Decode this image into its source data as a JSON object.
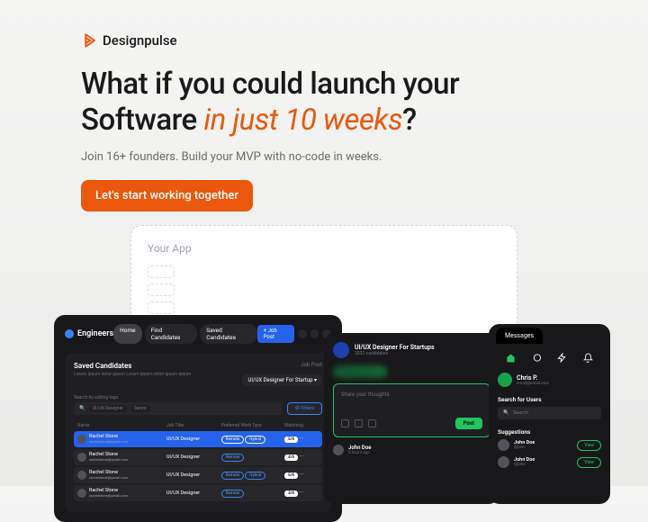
{
  "brand": "Designpulse",
  "headline_a": "What if you could launch your Software ",
  "headline_b": "in just 10 weeks",
  "headline_c": "?",
  "subhead": "Join 16+ founders. Build your MVP with no-code in weeks.",
  "cta": "Let's start working together",
  "wire": {
    "title": "Your App"
  },
  "eng": {
    "brand": "Engineers",
    "nav": [
      "Home",
      "Find Candidates",
      "Saved Candidates"
    ],
    "job_post_btn": "+ Job Post",
    "saved_title": "Saved Candidates",
    "lorem": "Lorum ipsum dolor ipsum Lorum ipsum dolor ipsum ipsum",
    "job_post_label": "Job Post",
    "job_post_value": "UI/UX Designer For Startup",
    "search_label": "Search by adding tags..",
    "tags": [
      "UI/UX Designer",
      "Senior"
    ],
    "filter": "Filters",
    "cols": [
      "Name",
      "Job Title",
      "Preferred Work Type",
      "Matching"
    ],
    "rows": [
      {
        "name": "Rachel Stone",
        "email": "rachelstone@gmail.com",
        "title": "UI/UX Designer",
        "types": [
          "Remote",
          "Hybrid"
        ],
        "match": "5/6",
        "sel": true
      },
      {
        "name": "Rachel Stone",
        "email": "rachelstone@gmail.com",
        "title": "UI/UX Designer",
        "types": [
          "Remote"
        ],
        "match": "4/6",
        "sel": false
      },
      {
        "name": "Rachel Stone",
        "email": "rachelstone@gmail.com",
        "title": "UI/UX Designer",
        "types": [
          "Remote",
          "Hybrid"
        ],
        "match": "5/6",
        "sel": false
      },
      {
        "name": "Rachel Stone",
        "email": "rachelstone@gmail.com",
        "title": "UI/UX Designer",
        "types": [
          "Remote"
        ],
        "match": "3/6",
        "sel": false
      }
    ]
  },
  "feed": {
    "title": "UI/UX Designer For Startups",
    "sub": "2032 candidates",
    "share": "Share your thoughts",
    "post": "Post",
    "item_name": "John Doe",
    "item_time": "2 hours ago"
  },
  "msg": {
    "tab": "Messages",
    "user_name": "Chris P.",
    "user_email": "email@email.com",
    "search_label": "Search for Users",
    "search_ph": "Search",
    "sugg_label": "Suggestions",
    "sugg": [
      {
        "name": "John Doe",
        "handle": "@john",
        "btn": "View"
      },
      {
        "name": "John Doe",
        "handle": "@john",
        "btn": "View"
      }
    ]
  }
}
